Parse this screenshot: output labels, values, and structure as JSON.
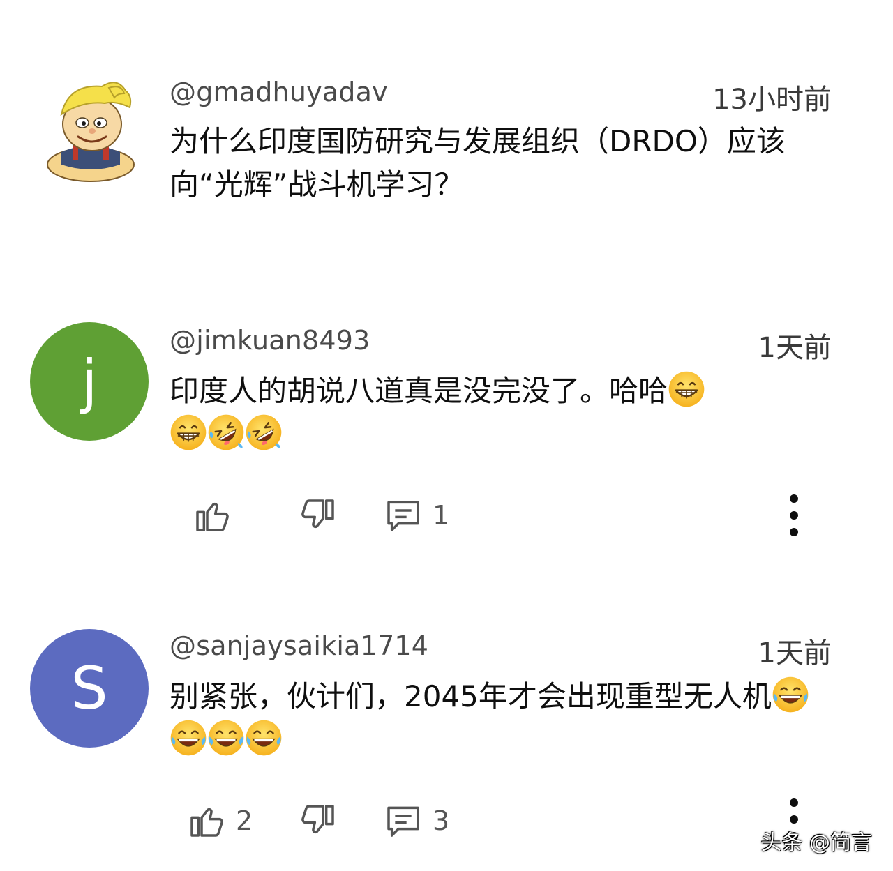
{
  "comments": [
    {
      "username": "@gmadhuyadav",
      "timestamp": "13小时前",
      "text": "为什么印度国防研究与发展组织（DRDO）应该向“光辉”战斗机学习？",
      "avatar": {
        "type": "cartoon",
        "icon": "cartoon-boy-avatar"
      }
    },
    {
      "username": "@jimkuan8493",
      "timestamp": "1天前",
      "text": "印度人的胡说八道真是没完没了。哈哈",
      "emojis": [
        "grinning-face",
        "grinning-face",
        "rofl-face",
        "rofl-face"
      ],
      "avatar": {
        "type": "letter",
        "letter": "j",
        "color": "#5fa034"
      },
      "actions": {
        "like_count": "",
        "reply_count": "1"
      }
    },
    {
      "username": "@sanjaysaikia1714",
      "timestamp": "1天前",
      "text": "别紧张，伙计们，2045年才会出现重型无人机",
      "emojis": [
        "tears-of-joy-face",
        "tears-of-joy-face",
        "tears-of-joy-face",
        "tears-of-joy-face"
      ],
      "avatar": {
        "type": "letter",
        "letter": "S",
        "color": "#5c6bc0"
      },
      "actions": {
        "like_count": "2",
        "reply_count": "3"
      }
    }
  ],
  "watermark": "头条 @简言"
}
